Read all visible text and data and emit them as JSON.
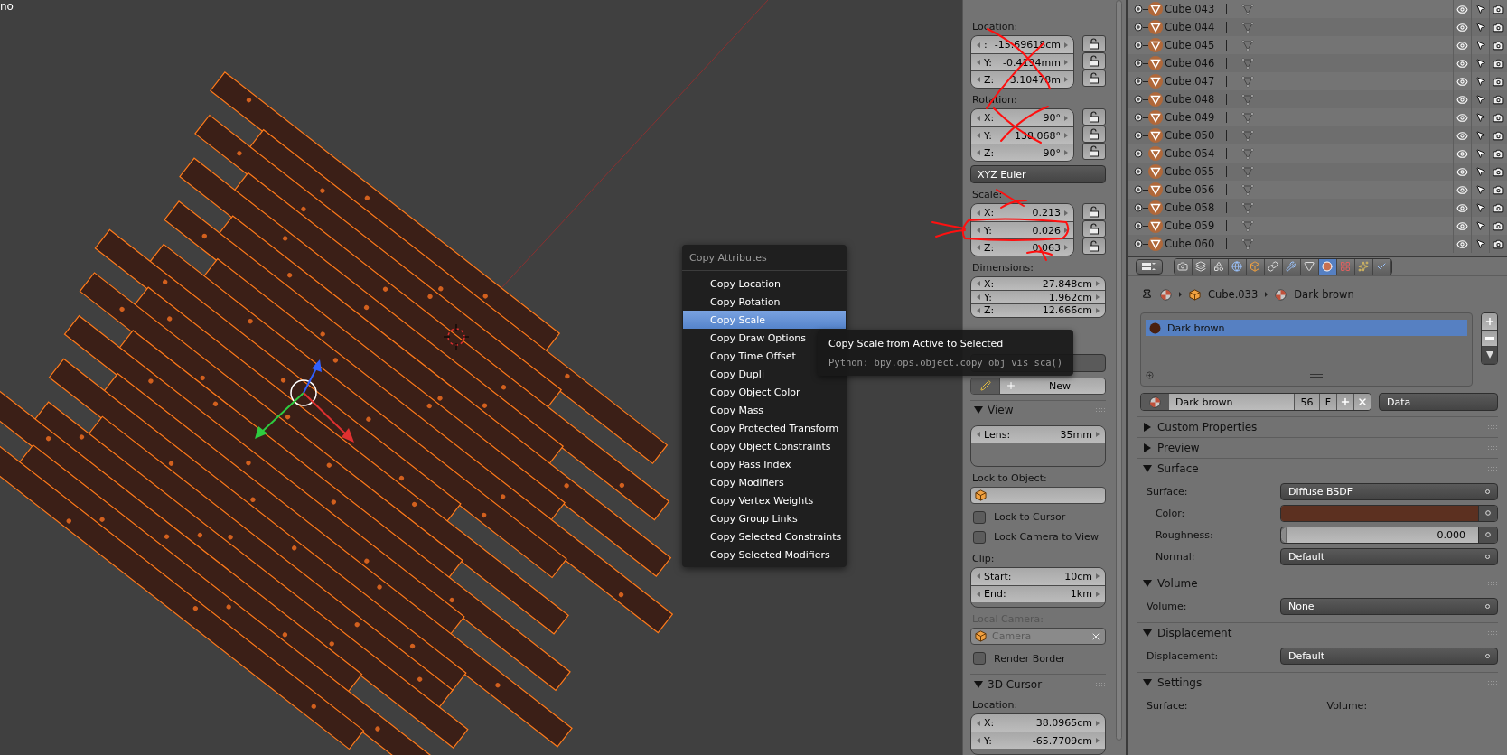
{
  "viewport": {
    "corner_text": "no"
  },
  "n_panel": {
    "location": {
      "label": "Location:",
      "fields": [
        {
          "axis": ":",
          "value": "-15.69618cm"
        },
        {
          "axis": "Y:",
          "value": "-0.4194mm"
        },
        {
          "axis": "Z:",
          "value": "3.10478m"
        }
      ]
    },
    "rotation": {
      "label": "Rotation:",
      "fields": [
        {
          "axis": "X:",
          "value": "90°"
        },
        {
          "axis": "Y:",
          "value": "138.068°"
        },
        {
          "axis": "Z:",
          "value": "90°"
        }
      ]
    },
    "rotation_mode": "XYZ Euler",
    "scale": {
      "label": "Scale:",
      "fields": [
        {
          "axis": "X:",
          "value": "0.213"
        },
        {
          "axis": "Y:",
          "value": "0.026"
        },
        {
          "axis": "Z:",
          "value": "0.063"
        }
      ]
    },
    "dimensions": {
      "label": "Dimensions:",
      "fields": [
        {
          "axis": "X:",
          "value": "27.848cm"
        },
        {
          "axis": "Y:",
          "value": "1.962cm"
        },
        {
          "axis": "Z:",
          "value": "12.666cm"
        }
      ]
    },
    "grease_pencil": {
      "new_label": "New"
    },
    "view": {
      "title": "View",
      "expanded": true,
      "lens": {
        "axis": "Lens:",
        "value": "35mm"
      },
      "lock_to_object_label": "Lock to Object:",
      "checks": [
        {
          "label": "Lock to Cursor",
          "checked": false
        },
        {
          "label": "Lock Camera to View",
          "checked": false
        }
      ],
      "clip_label": "Clip:",
      "clip": [
        {
          "axis": "Start:",
          "value": "10cm"
        },
        {
          "axis": "End:",
          "value": "1km"
        }
      ],
      "local_camera_label": "Local Camera:",
      "local_camera": "Camera",
      "render_border": {
        "label": "Render Border",
        "checked": false
      }
    },
    "cursor": {
      "title": "3D Cursor",
      "expanded": true,
      "location_label": "Location:",
      "fields": [
        {
          "axis": "X:",
          "value": "38.0965cm"
        },
        {
          "axis": "Y:",
          "value": "-65.7709cm"
        }
      ]
    }
  },
  "context_menu": {
    "title": "Copy Attributes",
    "items": [
      {
        "label": "Copy Location",
        "selected": false
      },
      {
        "label": "Copy Rotation",
        "selected": false
      },
      {
        "label": "Copy Scale",
        "selected": true
      },
      {
        "label": "Copy Draw Options",
        "selected": false
      },
      {
        "label": "Copy Time Offset",
        "selected": false
      },
      {
        "label": "Copy Dupli",
        "selected": false
      },
      {
        "label": "Copy Object Color",
        "selected": false
      },
      {
        "label": "Copy Mass",
        "selected": false
      },
      {
        "label": "Copy Protected Transform",
        "selected": false
      },
      {
        "label": "Copy Object Constraints",
        "selected": false
      },
      {
        "label": "Copy Pass Index",
        "selected": false
      },
      {
        "label": "Copy Modifiers",
        "selected": false
      },
      {
        "label": "Copy Vertex Weights",
        "selected": false
      },
      {
        "label": "Copy Group Links",
        "selected": false
      },
      {
        "label": "Copy Selected Constraints",
        "selected": false
      },
      {
        "label": "Copy Selected Modifiers",
        "selected": false
      }
    ]
  },
  "tooltip": {
    "title": "Copy Scale from Active to Selected",
    "python": "Python: bpy.ops.object.copy_obj_vis_sca()"
  },
  "outliner": {
    "rows": [
      {
        "name": "Cube.043"
      },
      {
        "name": "Cube.044"
      },
      {
        "name": "Cube.045"
      },
      {
        "name": "Cube.046"
      },
      {
        "name": "Cube.047"
      },
      {
        "name": "Cube.048"
      },
      {
        "name": "Cube.049"
      },
      {
        "name": "Cube.050"
      },
      {
        "name": "Cube.054"
      },
      {
        "name": "Cube.055"
      },
      {
        "name": "Cube.056"
      },
      {
        "name": "Cube.058"
      },
      {
        "name": "Cube.059"
      },
      {
        "name": "Cube.060"
      }
    ]
  },
  "properties": {
    "tabs": [
      {
        "kind": "render",
        "selected": false
      },
      {
        "kind": "layers",
        "selected": false
      },
      {
        "kind": "scene",
        "selected": false
      },
      {
        "kind": "world",
        "selected": false
      },
      {
        "kind": "object",
        "selected": false
      },
      {
        "kind": "constraints",
        "selected": false
      },
      {
        "kind": "modifiers",
        "selected": false
      },
      {
        "kind": "data",
        "selected": false
      },
      {
        "kind": "material",
        "selected": true
      },
      {
        "kind": "texture",
        "selected": false
      },
      {
        "kind": "particles",
        "selected": false
      },
      {
        "kind": "physics",
        "selected": false
      }
    ],
    "breadcrumb": [
      "Cube.033",
      "Dark brown"
    ],
    "slots": [
      {
        "name": "Dark brown",
        "selected": true
      }
    ],
    "material": {
      "name": "Dark brown",
      "users": "56",
      "fake": "F",
      "link": "Data"
    },
    "panels": [
      {
        "title": "Custom Properties",
        "expanded": false
      },
      {
        "title": "Preview",
        "expanded": false
      },
      {
        "title": "Surface",
        "expanded": true,
        "rows": [
          {
            "kind": "dropdown",
            "label": "Surface:",
            "value": "Diffuse BSDF"
          },
          {
            "kind": "color",
            "label": "Color:",
            "color": "#5c3020"
          },
          {
            "kind": "slider",
            "label": "Roughness:",
            "value": "0.000",
            "level": 0
          },
          {
            "kind": "socket",
            "label": "Normal:",
            "value": "Default"
          }
        ]
      },
      {
        "title": "Volume",
        "expanded": true,
        "rows": [
          {
            "kind": "dropdown",
            "label": "Volume:",
            "value": "None"
          }
        ]
      },
      {
        "title": "Displacement",
        "expanded": true,
        "rows": [
          {
            "kind": "dropdown",
            "label": "Displacement:",
            "value": "Default"
          }
        ]
      },
      {
        "title": "Settings",
        "expanded": true,
        "rows": [
          {
            "kind": "pair",
            "label": "Surface:",
            "value": "Volume:"
          }
        ]
      }
    ]
  }
}
